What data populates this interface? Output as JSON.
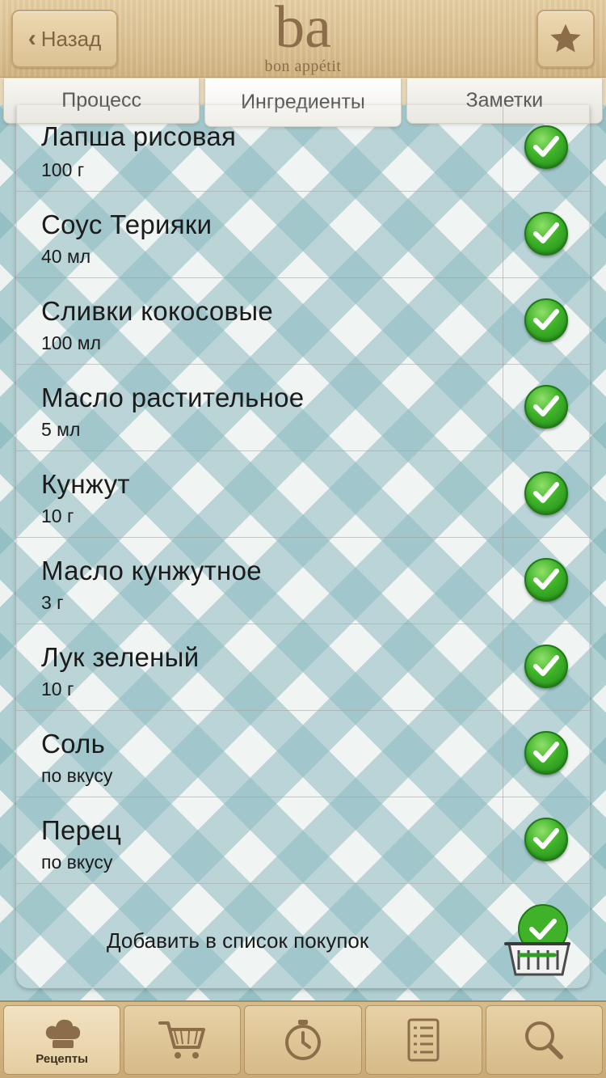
{
  "header": {
    "back_label": "Назад",
    "logo_mark": "ba",
    "logo_text": "bon appétit",
    "favorite_icon": "star-icon"
  },
  "tabs": [
    {
      "label": "Процесс",
      "active": false
    },
    {
      "label": "Ингредиенты",
      "active": true
    },
    {
      "label": "Заметки",
      "active": false
    }
  ],
  "ingredients": [
    {
      "name": "Лапша рисовая",
      "qty": "100 г",
      "checked": true
    },
    {
      "name": "Соус Терияки",
      "qty": "40 мл",
      "checked": true
    },
    {
      "name": "Сливки кокосовые",
      "qty": "100 мл",
      "checked": true
    },
    {
      "name": "Масло растительное",
      "qty": "5 мл",
      "checked": true
    },
    {
      "name": "Кунжут",
      "qty": "10 г",
      "checked": true
    },
    {
      "name": "Масло кунжутное",
      "qty": "3 г",
      "checked": true
    },
    {
      "name": "Лук зеленый",
      "qty": "10 г",
      "checked": true
    },
    {
      "name": "Соль",
      "qty": "по вкусу",
      "checked": true
    },
    {
      "name": "Перец",
      "qty": "по вкусу",
      "checked": true
    }
  ],
  "add_to_list": {
    "label": "Добавить в список покупок",
    "icon": "basket-icon"
  },
  "bottom_nav": [
    {
      "label": "Рецепты",
      "icon": "chef-hat-icon",
      "active": true
    },
    {
      "label": "",
      "icon": "cart-icon",
      "active": false
    },
    {
      "label": "",
      "icon": "timer-icon",
      "active": false
    },
    {
      "label": "",
      "icon": "notes-icon",
      "active": false
    },
    {
      "label": "",
      "icon": "search-icon",
      "active": false
    }
  ],
  "colors": {
    "wood": "#dcc192",
    "check_green": "#3fb229",
    "tablecloth_blue": "#7eb2b8"
  }
}
